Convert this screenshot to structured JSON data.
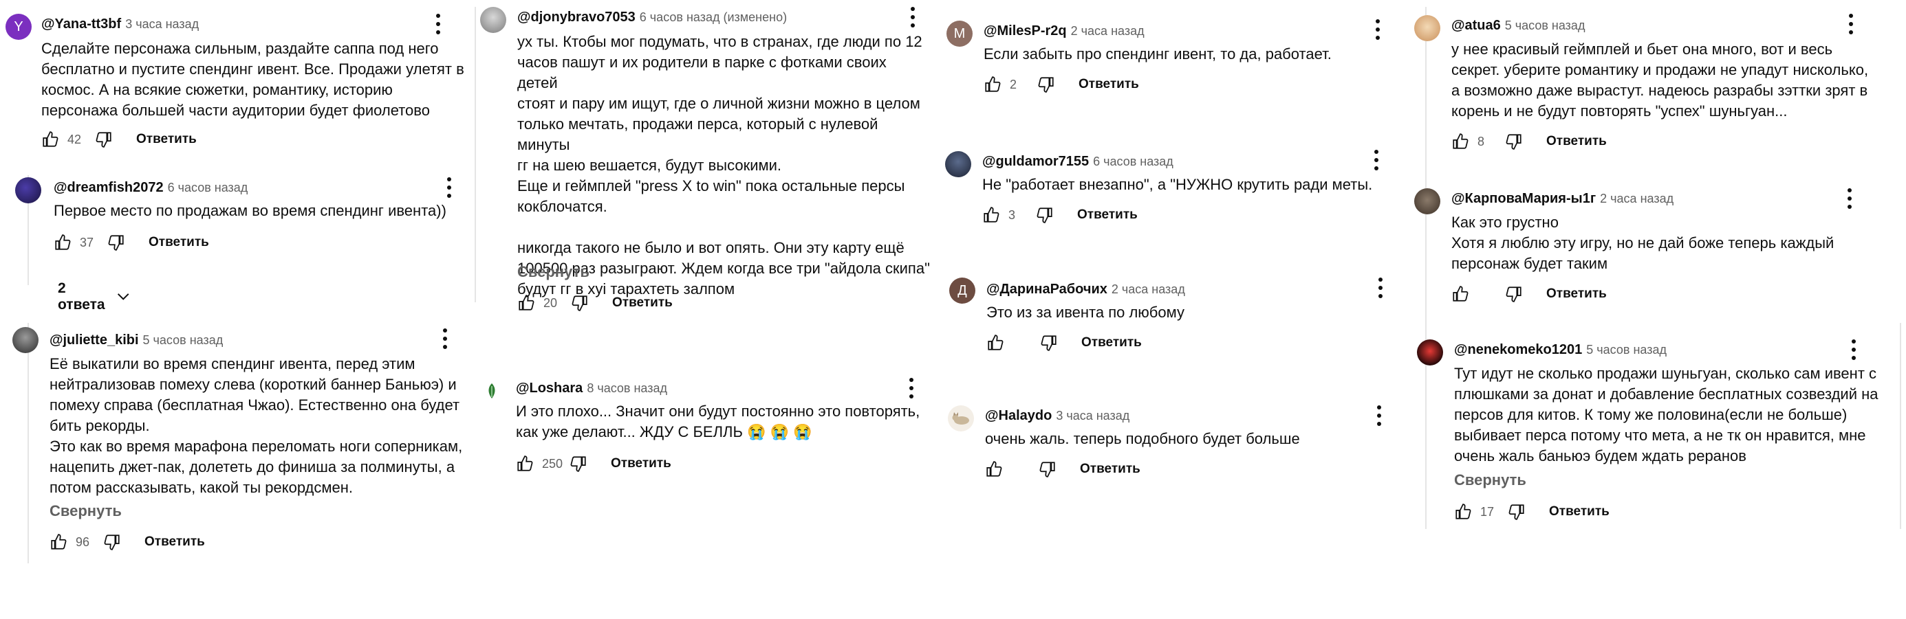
{
  "actions": {
    "reply_label": "Ответить",
    "collapse_label": "Свернуть"
  },
  "comments": [
    {
      "author": "@Yana-tt3bf",
      "time": "3 часа назад",
      "likes": "42",
      "text": "Сделайте персонажа сильным, раздайте саппа под него\nбесплатно и пустите спендинг ивент. Все. Продажи улетят в\nкосмос. А на всякие сюжетки, романтику, историю\nперсонажа большей части аудитории будет фиолетово",
      "avatar": {
        "letter": "Y",
        "color": "#7b2fbf"
      }
    },
    {
      "author": "@dreamfish2072",
      "time": "6 часов назад",
      "likes": "37",
      "text": "Первое место по продажам во время спендинг ивента))",
      "replies_label": "2 ответа"
    },
    {
      "author": "@juliette_kibi",
      "time": "5 часов назад",
      "likes": "96",
      "text": "Её выкатили во время спендинг ивента, перед этим\nнейтрализовав помеху слева (короткий баннер Баньюэ) и\nпомеху справа (бесплатная Чжао). Естественно она будет\nбить рекорды.\nЭто как во время марафона переломать ноги соперникам,\nнацепить джет-пак, долететь до финиша за полминуты, а\nпотом рассказывать, какой ты рекордсмен."
    },
    {
      "author": "@djonybravo7053",
      "time": "6 часов назад (изменено)",
      "likes": "20",
      "text": "ух ты. Ктобы мог подумать, что в странах, где люди по 12\nчасов пашут и их родители в парке с фотками своих детей\nстоят и пару им ищут, где о личной жизни можно в целом\nтолько мечтать, продажи перса, который с нулевой минуты\nгг на шею вешается, будут высокими.\nЕще и геймплей \"press X to win\" пока остальные персы\nкокблочатся.\n\nникогда такого не было и вот опять. Они эту карту ещё\n100500 раз разыграют. Ждем когда все три \"айдола скипа\"\nбудут  гг в хуі тарахтеть залпом"
    },
    {
      "author": "@Loshara",
      "time": "8 часов назад",
      "likes": "250",
      "text": "И это плохо... Значит они будут постоянно это повторять,\nкак уже делают... ЖДУ С БЕЛЛЬ 😭 😭 😭"
    },
    {
      "author": "@MilesP-r2q",
      "time": "2 часа назад",
      "likes": "2",
      "text": "Если забыть про спендинг ивент, то да, работает.",
      "avatar": {
        "letter": "M",
        "color": "#8d6e63"
      }
    },
    {
      "author": "@guldamor7155",
      "time": "6 часов назад",
      "likes": "3",
      "text": "Не \"работает внезапно\", а \"НУЖНО крутить ради меты."
    },
    {
      "author": "@ДаринаРабочих",
      "time": "2 часа назад",
      "likes": "",
      "text": "Это из за ивента по любому",
      "avatar": {
        "letter": "Д",
        "color": "#6d4c41"
      }
    },
    {
      "author": "@Halaydo",
      "time": "3 часа назад",
      "likes": "",
      "text": "очень жаль. теперь подобного будет больше"
    },
    {
      "author": "@atua6",
      "time": "5 часов назад",
      "likes": "8",
      "text": "у нее красивый геймплей и бьет она много, вот и весь\nсекрет. уберите романтику и продажи не упадут нисколько,\nа возможно даже вырастут. надеюсь разрабы зэттки зрят в\nкорень и не будут повторять \"успех\" шуньгуан..."
    },
    {
      "author": "@КарповаМария-ы1г",
      "time": "2 часа назад",
      "likes": "",
      "text": "Как это грустно\nХотя я люблю эту игру, но не дай боже теперь каждый\nперсонаж будет таким"
    },
    {
      "author": "@nenekomeko1201",
      "time": "5 часов назад",
      "likes": "17",
      "text": "Тут идут не сколько продажи шуньгуан, сколько сам ивент с\nплюшками за донат и добавление бесплатных созвездий на\nперсов  для китов. К тому же половина(если не больше)\nвыбивает перса потому что мета, а не тк он нравится, мне\nочень жаль баньюэ будем ждать реранов"
    }
  ]
}
